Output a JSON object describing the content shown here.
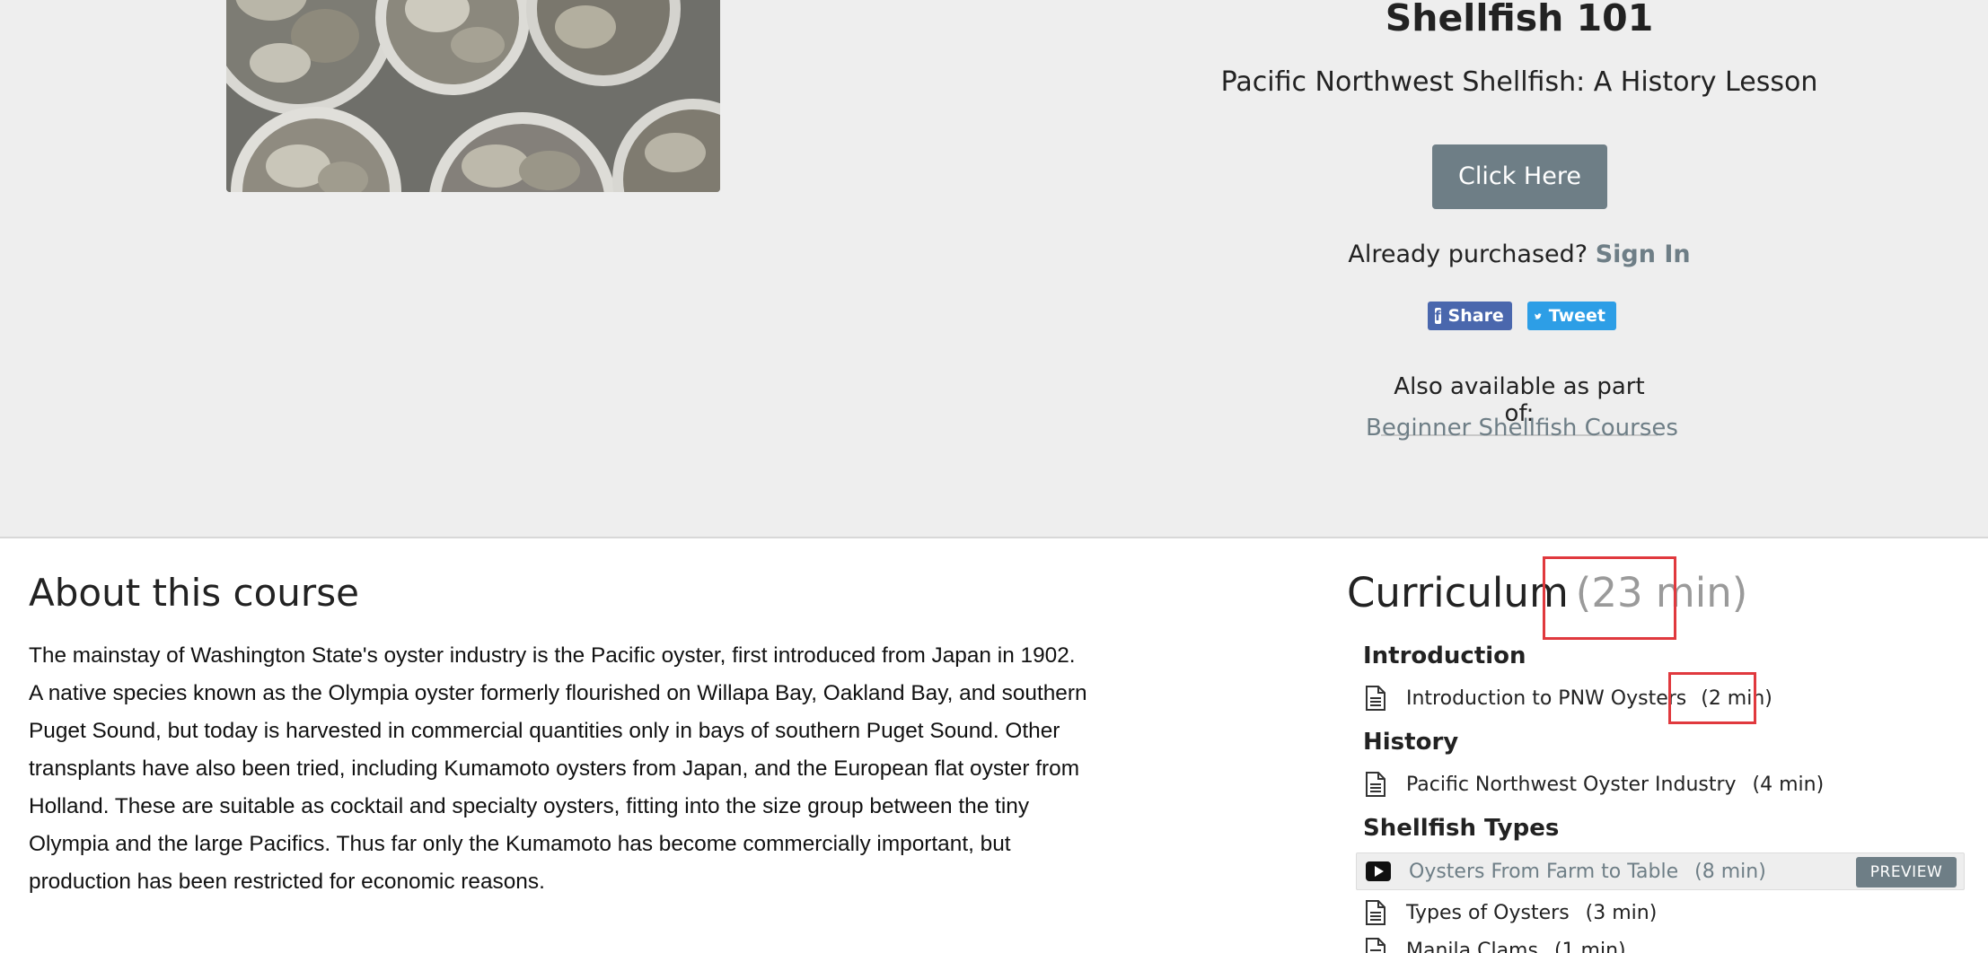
{
  "hero": {
    "title": "Shellfish 101",
    "subtitle": "Pacific Northwest Shellfish: A History Lesson",
    "cta_label": "Click Here",
    "purchased_text": "Already purchased?",
    "signin_label": "Sign In",
    "share": {
      "facebook_label": "Share",
      "twitter_label": "Tweet"
    },
    "also_available_label": "Also available as part of:",
    "bundle_link": "Beginner Shellfish Courses"
  },
  "about": {
    "title": "About this course",
    "lines": [
      "The mainstay of Washington State's oyster industry is the Pacific oyster, first introduced from Japan in 1902.",
      "A native species known as the Olympia oyster formerly flourished on Willapa Bay, Oakland Bay, and southern",
      "Puget Sound, but today is harvested in commercial quantities only in bays of southern Puget Sound. Other",
      "transplants have also been tried, including Kumamoto oysters from Japan, and the European flat oyster from",
      "Holland. These are suitable as cocktail and specialty oysters, fitting into the size group between the tiny",
      "Olympia and the large Pacifics. Thus far only the Kumamoto has become commercially important, but",
      "production has been restricted for economic reasons."
    ]
  },
  "curriculum": {
    "title": "Curriculum",
    "total": "(23 min)",
    "sections": [
      {
        "title": "Introduction",
        "lectures": [
          {
            "name": "Introduction to PNW Oysters",
            "duration": "(2 min)",
            "icon": "document-icon"
          }
        ]
      },
      {
        "title": "History",
        "lectures": [
          {
            "name": "Pacific Northwest Oyster Industry",
            "duration": "(4 min)",
            "icon": "document-icon"
          }
        ]
      },
      {
        "title": "Shellfish Types",
        "lectures": [
          {
            "name": "Oysters From Farm to Table",
            "duration": "(8 min)",
            "icon": "video-icon",
            "preview_label": "PREVIEW"
          },
          {
            "name": "Types of Oysters",
            "duration": "(3 min)",
            "icon": "document-icon"
          },
          {
            "name": "Manila Clams",
            "duration": "(1 min)",
            "icon": "document-icon"
          }
        ]
      }
    ]
  },
  "colors": {
    "accent": "#6e7e86",
    "highlight": "#e0393e",
    "facebook": "#4a67ad",
    "twitter": "#2d9ee6"
  }
}
